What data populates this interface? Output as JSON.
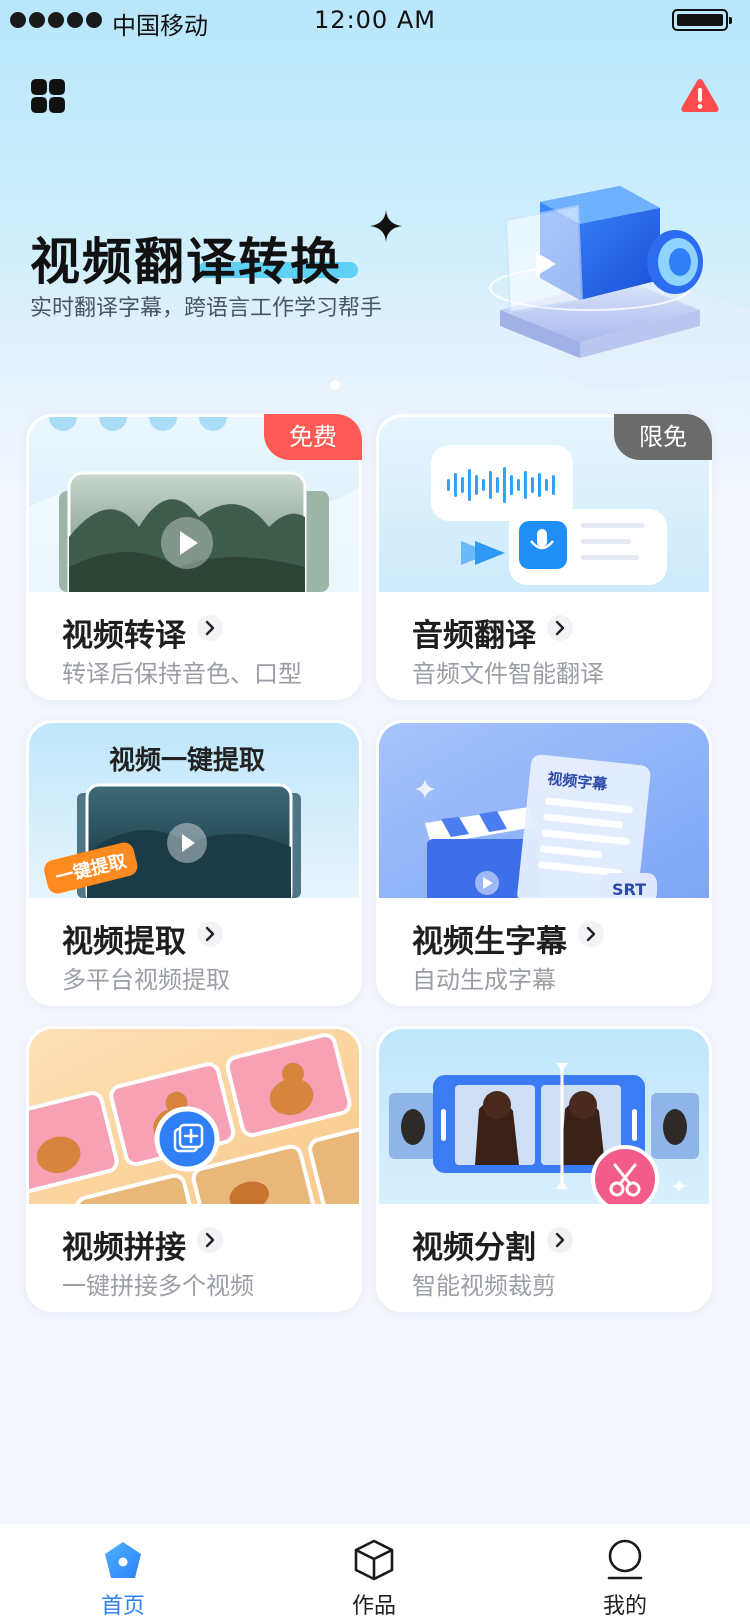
{
  "status_bar": {
    "carrier": "中国移动",
    "time": "12:00 AM"
  },
  "header": {
    "menu_icon": "grid-menu-icon",
    "alert_icon": "warning-icon",
    "alert_color": "#ff4b4b"
  },
  "hero": {
    "title": "视频翻译转换",
    "subtitle": "实时翻译字幕，跨语言工作学习帮手",
    "carousel_pages": 2,
    "carousel_active": 1
  },
  "features": [
    {
      "title": "视频转译",
      "desc": "转译后保持音色、口型",
      "badge": "免费"
    },
    {
      "title": "音频翻译",
      "desc": "音频文件智能翻译",
      "badge": "限免"
    },
    {
      "title": "视频提取",
      "desc": "多平台视频提取",
      "thumb_title": "视频一键提取",
      "thumb_tag": "一键提取"
    },
    {
      "title": "视频生字幕",
      "desc": "自动生成字幕",
      "thumb_doc_title": "视频字幕",
      "thumb_file_tag": "SRT"
    },
    {
      "title": "视频拼接",
      "desc": "一键拼接多个视频"
    },
    {
      "title": "视频分割",
      "desc": "智能视频裁剪"
    }
  ],
  "tabbar": {
    "items": [
      {
        "label": "首页",
        "icon": "home-icon",
        "active": true
      },
      {
        "label": "作品",
        "icon": "box-icon",
        "active": false
      },
      {
        "label": "我的",
        "icon": "profile-icon",
        "active": false
      }
    ],
    "active_color": "#2f7ff7"
  }
}
